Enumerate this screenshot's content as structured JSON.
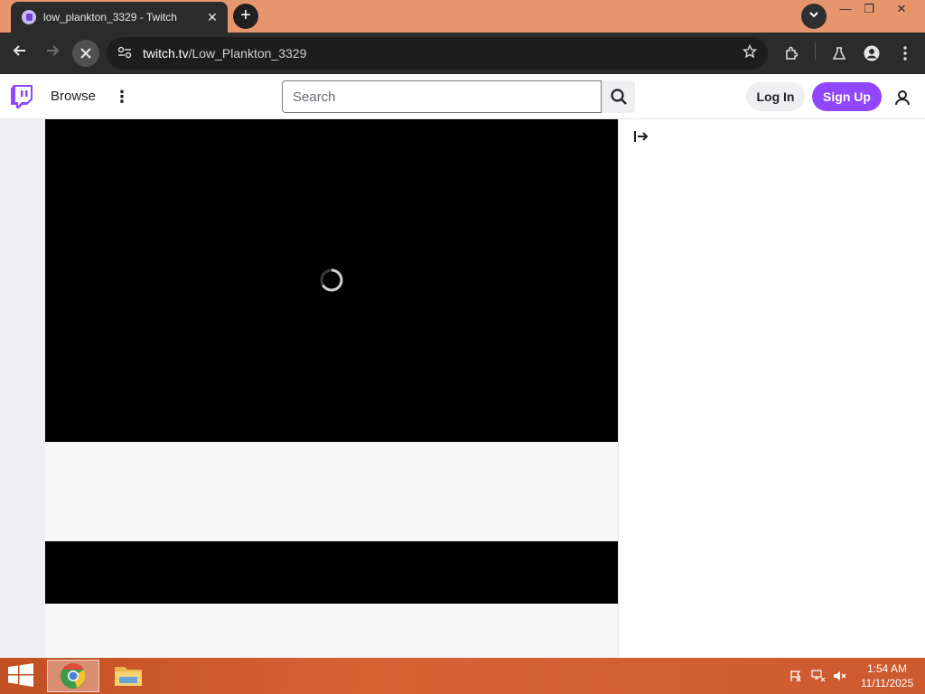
{
  "browser": {
    "tab_title": "low_plankton_3329 - Twitch",
    "tab_close": "✕",
    "new_tab": "+",
    "url_domain": "twitch.tv",
    "url_path": "/Low_Plankton_3329",
    "window_controls": {
      "minimize": "—",
      "restore": "❐",
      "close": "✕"
    }
  },
  "twitch": {
    "nav": {
      "browse": "Browse",
      "more": "⋮"
    },
    "search": {
      "placeholder": "Search"
    },
    "auth": {
      "login": "Log In",
      "signup": "Sign Up"
    },
    "colors": {
      "brand": "#9146ff"
    }
  },
  "player": {
    "state": "loading"
  },
  "taskbar": {
    "time": "1:54 AM",
    "date": "11/11/2025"
  }
}
